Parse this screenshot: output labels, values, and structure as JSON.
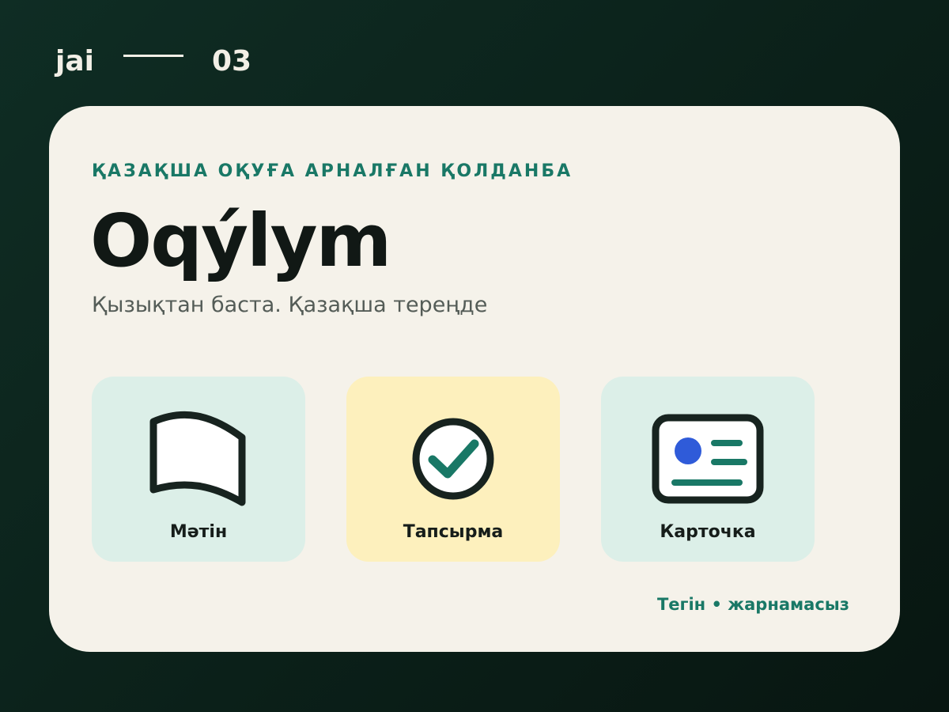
{
  "header": {
    "brand": "jai",
    "page_number": "03"
  },
  "card": {
    "eyebrow": "ҚАЗАҚША ОҚУҒА АРНАЛҒАН ҚОЛДАНБА",
    "title": "Oqýlym",
    "subtitle": "Қызықтан баста. Қазақша тереңде",
    "tiles": [
      {
        "label": "Мәтін",
        "icon": "book-page-icon",
        "background": "#dcefe8"
      },
      {
        "label": "Тапсырма",
        "icon": "check-circle-icon",
        "background": "#fdf0bd"
      },
      {
        "label": "Карточка",
        "icon": "id-card-icon",
        "background": "#dcefe8"
      }
    ],
    "footer": "Тегін • жарнамасыз"
  },
  "colors": {
    "background": "#0d261e",
    "card": "#f5f2ea",
    "accent": "#197866",
    "text": "#111815",
    "card_dot": "#2f5bd9"
  }
}
